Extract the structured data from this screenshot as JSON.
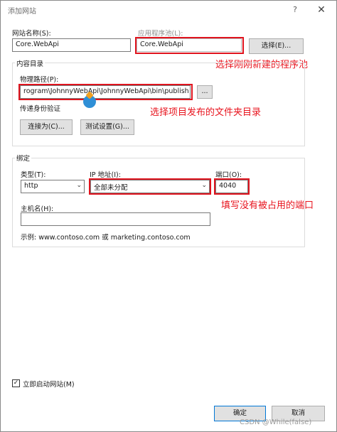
{
  "window": {
    "title": "添加网站",
    "help": "?",
    "close": "✕"
  },
  "site": {
    "name_label": "网站名称(S):",
    "name_value": "Core.WebApi",
    "pool_label": "应用程序池(L):",
    "pool_value": "Core.WebApi",
    "select_button": "选择(E)..."
  },
  "content": {
    "group_title": "内容目录",
    "path_label": "物理路径(P):",
    "path_value": "rogram\\JohnnyWebApi\\JohnnyWebApi\\bin\\publish",
    "browse_button": "...",
    "auth_label": "传递身份验证",
    "connect_as_button": "连接为(C)...",
    "test_settings_button": "测试设置(G)..."
  },
  "binding": {
    "group_title": "绑定",
    "type_label": "类型(T):",
    "type_value": "http",
    "ip_label": "IP 地址(I):",
    "ip_value": "全部未分配",
    "port_label": "端口(O):",
    "port_value": "4040",
    "host_label": "主机名(H):",
    "host_value": "",
    "example": "示例: www.contoso.com 或 marketing.contoso.com"
  },
  "start_now": {
    "label": "立即启动网站(M)",
    "checked": true
  },
  "footer": {
    "ok": "确定",
    "cancel": "取消"
  },
  "annotations": {
    "pool_note": "选择刚刚新建的程序池",
    "path_note": "选择项目发布的文件夹目录",
    "port_note": "填写没有被占用的端口"
  },
  "watermark": "CSDN @While(false)",
  "colors": {
    "annotation_red": "#e0141e"
  }
}
